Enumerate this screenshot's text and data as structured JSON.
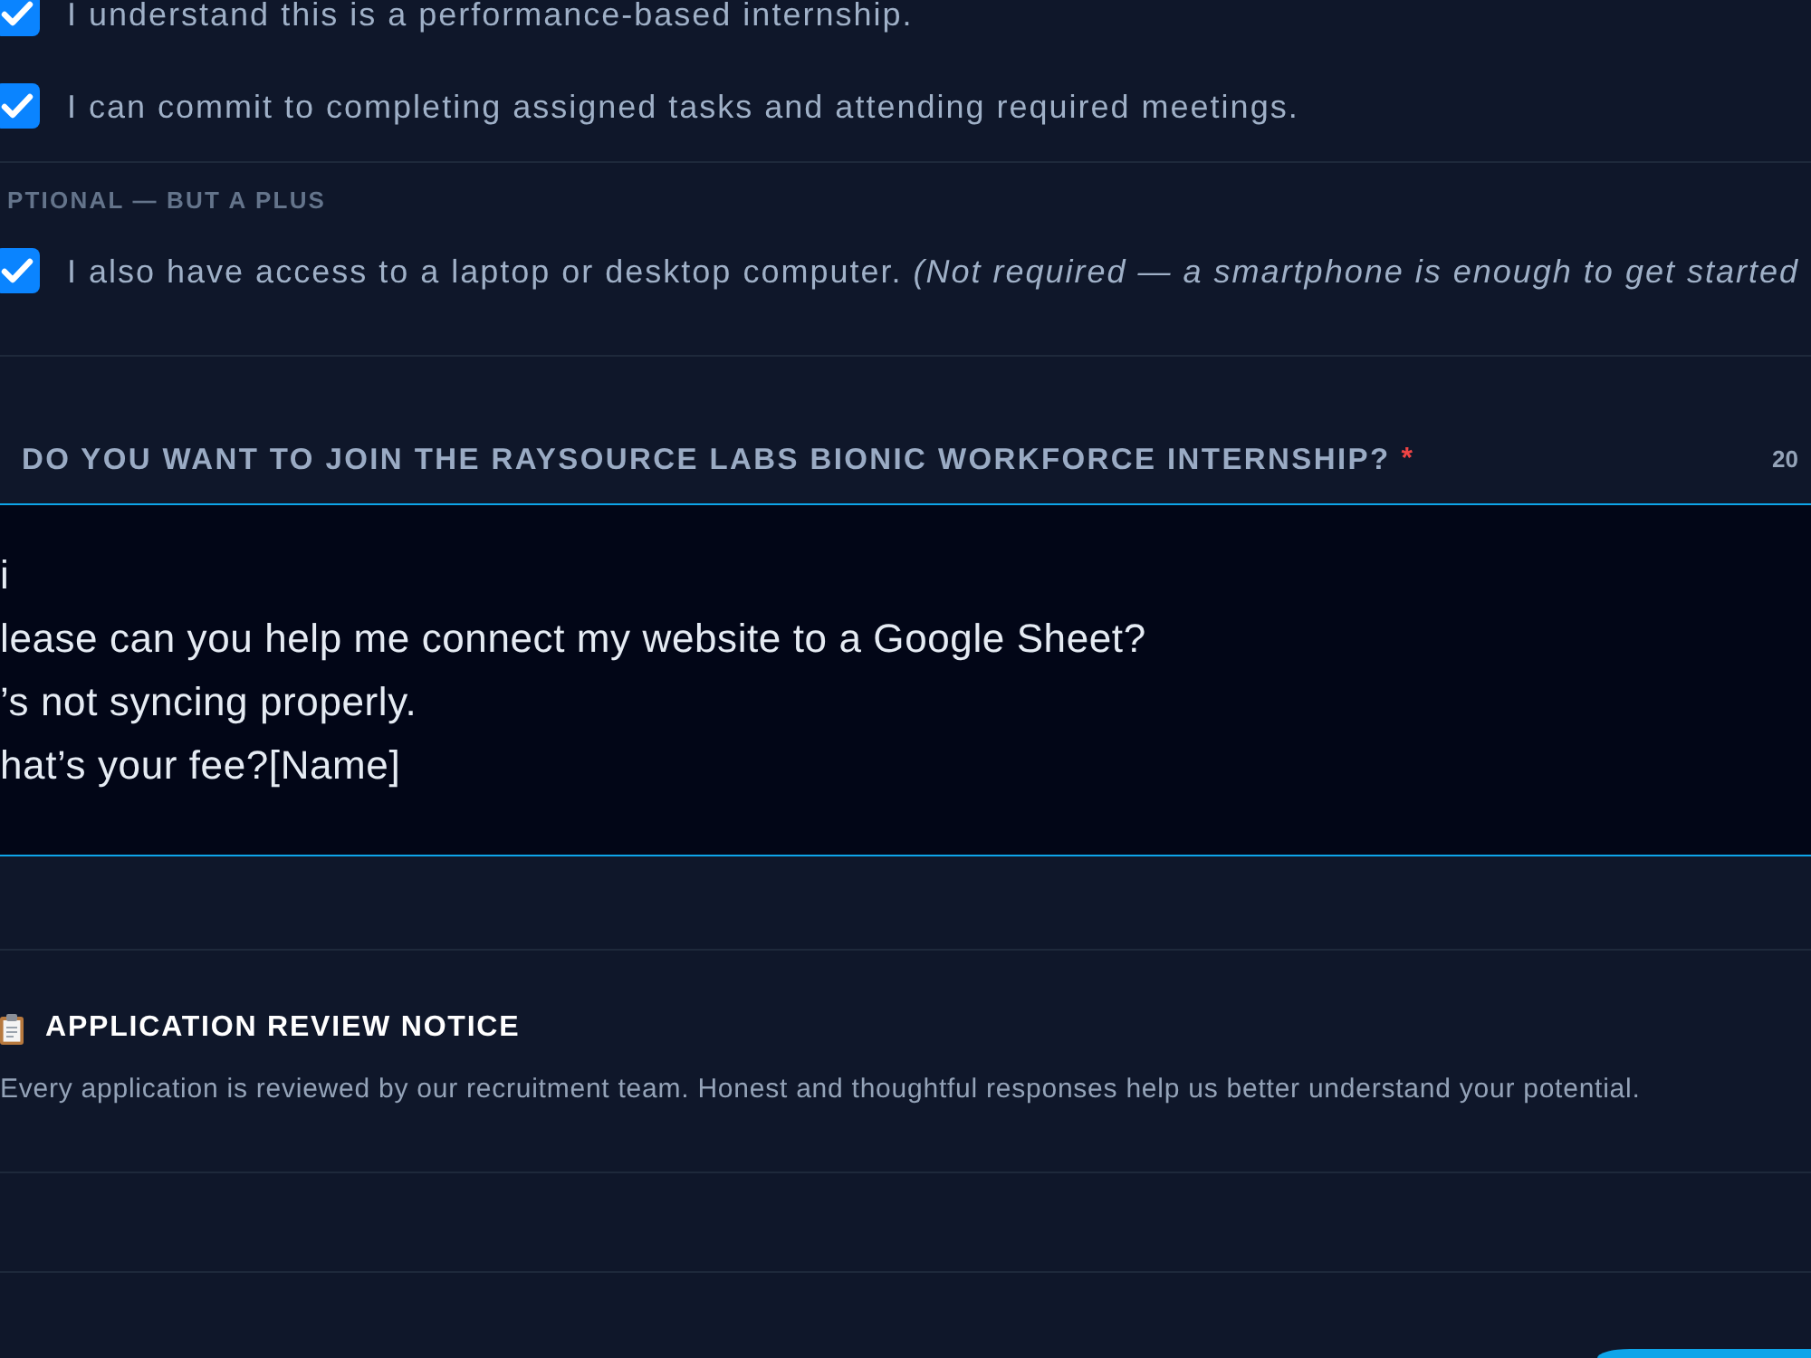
{
  "acknowledgements": {
    "items": [
      {
        "label": "I understand this is a performance-based internship.",
        "checked": true
      },
      {
        "label": "I can commit to completing assigned tasks and attending required meetings.",
        "checked": true
      }
    ]
  },
  "optional": {
    "heading": "PTIONAL — BUT A PLUS",
    "items": [
      {
        "label": "I also have access to a laptop or desktop computer. *(Not required — a smartphone is enough to get started*",
        "checked": true
      }
    ]
  },
  "question": {
    "label": "DO YOU WANT TO JOIN THE RAYSOURCE LABS BIONIC WORKFORCE INTERNSHIP?",
    "required_mark": "*",
    "counter": "20",
    "answer": "i\nlease can you help me connect my website to a Google Sheet?\n’s not syncing properly.\nhat’s your fee?[Name]"
  },
  "notice": {
    "title": "APPLICATION REVIEW NOTICE",
    "text": "Every application is reviewed by our recruitment team. Honest and thoughtful responses help us better understand your potential."
  }
}
